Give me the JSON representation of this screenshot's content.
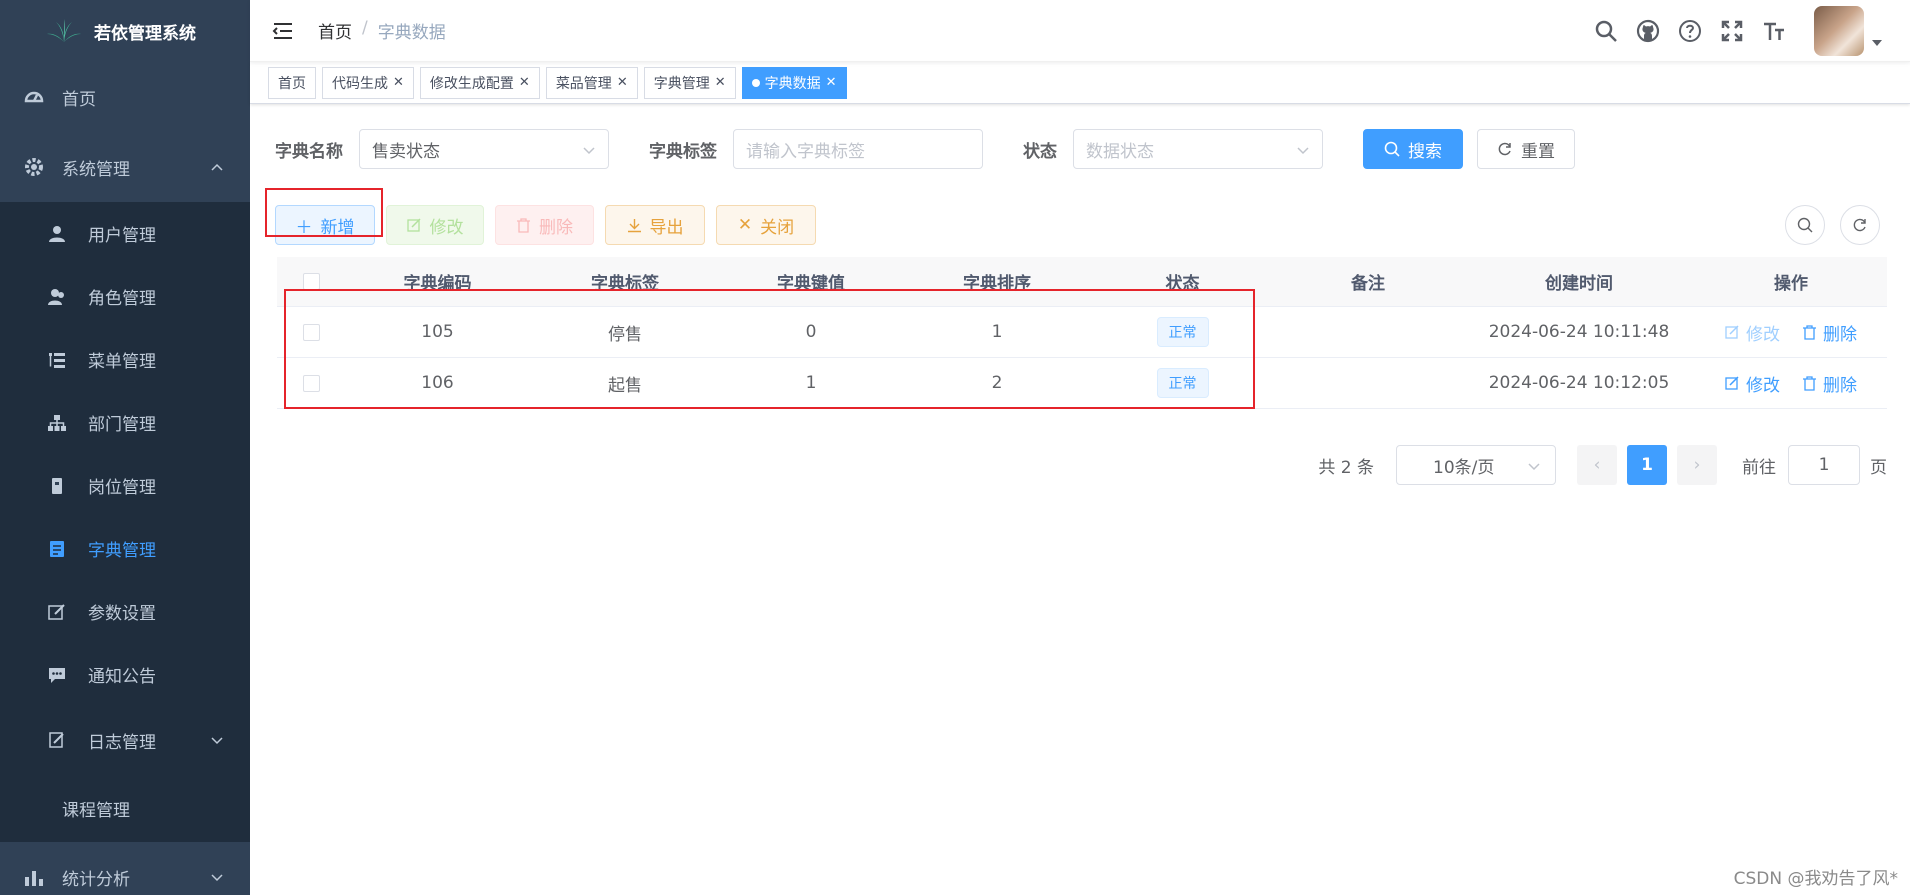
{
  "app": {
    "title": "若依管理系统"
  },
  "sidebar": {
    "home": "首页",
    "system": "系统管理",
    "system_items": [
      "用户管理",
      "角色管理",
      "菜单管理",
      "部门管理",
      "岗位管理",
      "字典管理",
      "参数设置",
      "通知公告",
      "日志管理"
    ],
    "course": "课程管理",
    "stats": "统计分析"
  },
  "breadcrumb": {
    "home": "首页",
    "sep": "/",
    "current": "字典数据"
  },
  "tags": [
    "首页",
    "代码生成",
    "修改生成配置",
    "菜品管理",
    "字典管理",
    "字典数据"
  ],
  "search": {
    "dict_name_label": "字典名称",
    "dict_name_value": "售卖状态",
    "dict_label_label": "字典标签",
    "dict_label_placeholder": "请输入字典标签",
    "status_label": "状态",
    "status_placeholder": "数据状态",
    "search_btn": "搜索",
    "reset_btn": "重置"
  },
  "toolbar": {
    "add": "新增",
    "edit": "修改",
    "delete": "删除",
    "export": "导出",
    "close": "关闭"
  },
  "table": {
    "headers": [
      "字典编码",
      "字典标签",
      "字典键值",
      "字典排序",
      "状态",
      "备注",
      "创建时间",
      "操作"
    ],
    "rows": [
      {
        "code": "105",
        "label": "停售",
        "value": "0",
        "sort": "1",
        "status": "正常",
        "remark": "",
        "created": "2024-06-24 10:11:48",
        "edit": "修改",
        "del": "删除"
      },
      {
        "code": "106",
        "label": "起售",
        "value": "1",
        "sort": "2",
        "status": "正常",
        "remark": "",
        "created": "2024-06-24 10:12:05",
        "edit": "修改",
        "del": "删除"
      }
    ]
  },
  "pagination": {
    "total": "共 2 条",
    "page_size": "10条/页",
    "current": "1",
    "goto": "前往",
    "goto_value": "1",
    "page_unit": "页"
  },
  "watermark": "CSDN @我劝告了风*",
  "colors": {
    "primary": "#409eff",
    "sidebar_bg": "#304156",
    "submenu_bg": "#1f2d3d",
    "highlight_box": "#e5242b"
  }
}
